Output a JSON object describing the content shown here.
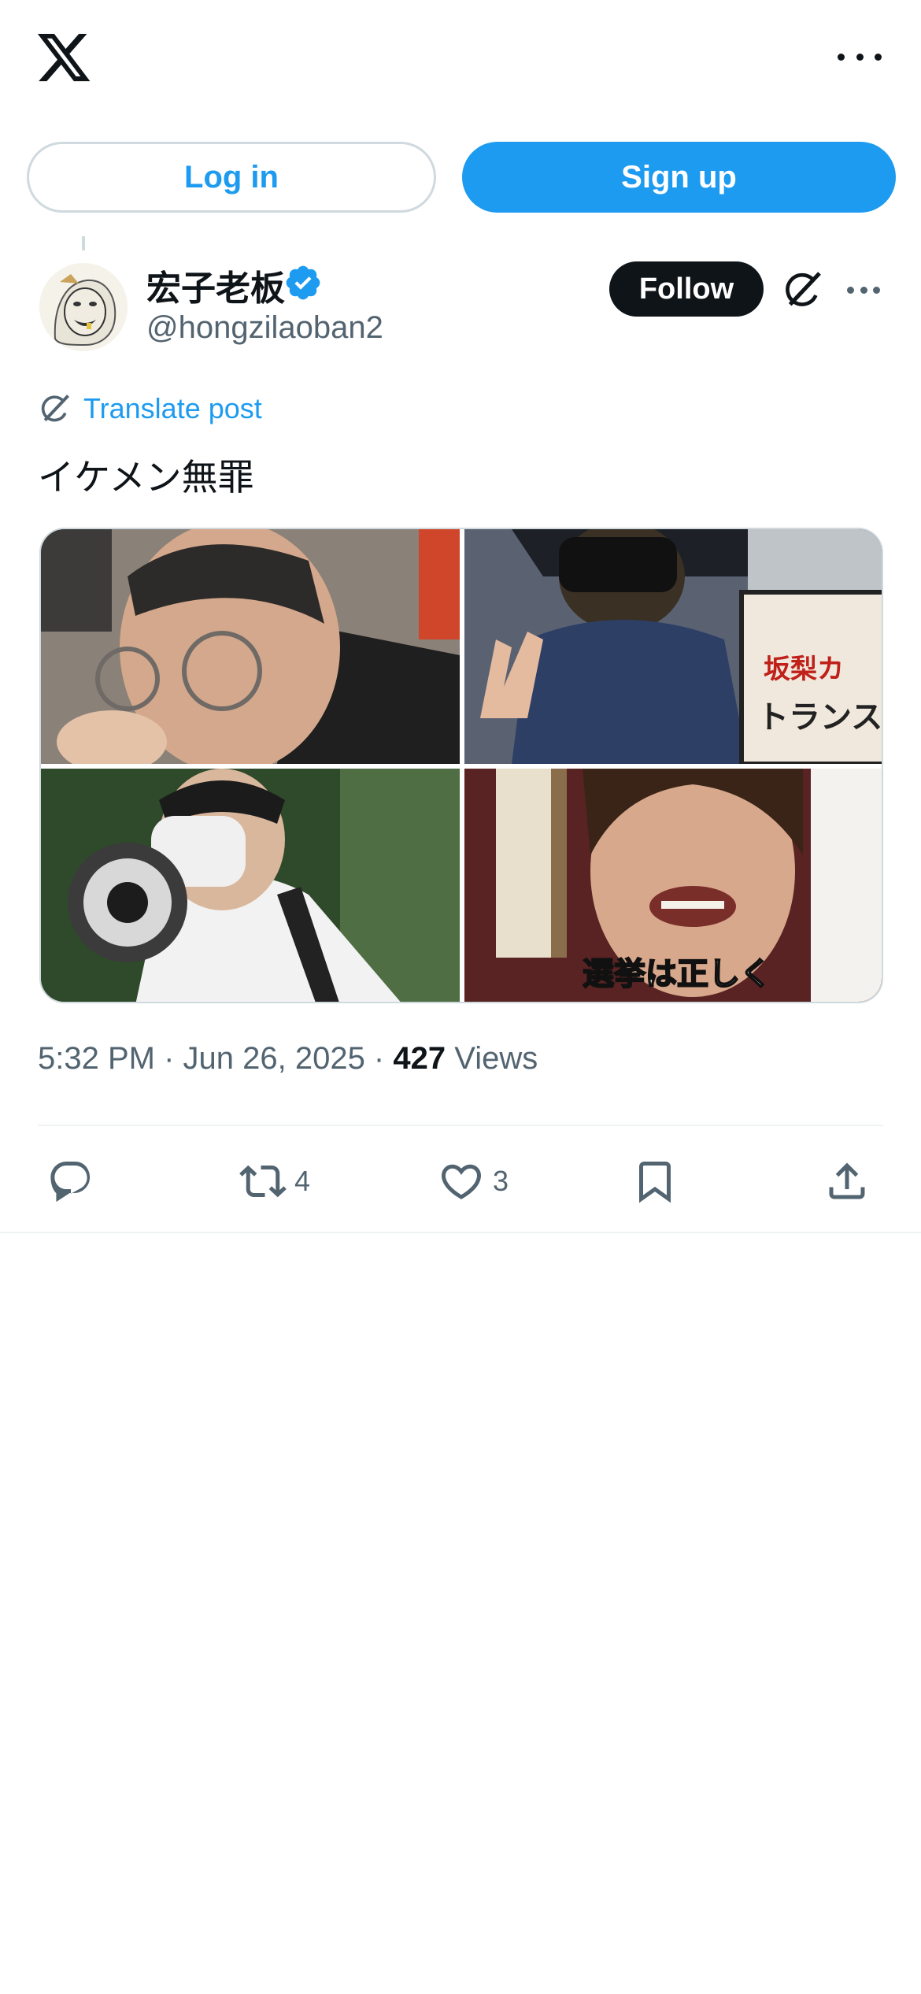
{
  "header": {
    "logo": "x-logo-icon",
    "more": "more-icon"
  },
  "auth": {
    "login_label": "Log in",
    "signup_label": "Sign up"
  },
  "post": {
    "author": {
      "display_name": "宏子老板",
      "handle": "@hongzilaoban2",
      "verified": true
    },
    "follow_label": "Follow",
    "translate_label": "Translate post",
    "text": "イケメン無罪",
    "media": {
      "count": 4,
      "image4_caption": "選挙は正しく",
      "image2_sign_line1": "坂梨カ",
      "image2_sign_line2": "トランス差"
    },
    "time": "5:32 PM · Jun 26, 2025 · ",
    "views_count": "427",
    "views_label": " Views",
    "stats": {
      "retweets": "4",
      "likes": "3"
    }
  },
  "colors": {
    "accent": "#1d9bf0",
    "text": "#0f1419",
    "muted": "#536471",
    "border": "#cfd9de"
  }
}
